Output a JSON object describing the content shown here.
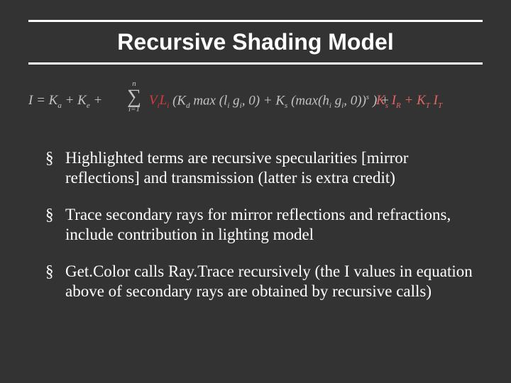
{
  "title": "Recursive Shading Model",
  "formula": {
    "lhs_prefix": "I = K",
    "lhs_a": "a",
    "lhs_plus": " + K",
    "lhs_e": "e",
    "lhs_plus2": " + ",
    "sigma_top": "n",
    "sigma_bottom": "i=1",
    "vi": "V",
    "vi_sub": "i",
    "li": "L",
    "li_sub": "i",
    "body1": " (K",
    "kd": "d",
    "body2": " max (l",
    "body2_sub": "i",
    "body2b": " g",
    "body2b_sub": "i",
    "body3": ", 0) + K",
    "ks": "s",
    "body4": " (max(h",
    "body4_sub": "i",
    "body4b": " g",
    "body4b_sub": "i",
    "body5": ", 0))",
    "exp_s": "s",
    "body6": " ) + ",
    "rec_ks": "K",
    "rec_ks_sub": "s",
    "rec_ir": " I",
    "rec_ir_sub": "R",
    "rec_plus": " + K",
    "rec_kt_sub": "T",
    "rec_it": " I",
    "rec_it_sub": "T"
  },
  "bullets": [
    "Highlighted terms are recursive specularities [mirror reflections] and transmission (latter is extra credit)",
    "Trace secondary rays for mirror reflections and refractions, include contribution in lighting model",
    "Get.Color calls Ray.Trace recursively (the I values in equation above of secondary rays are obtained by recursive calls)"
  ]
}
